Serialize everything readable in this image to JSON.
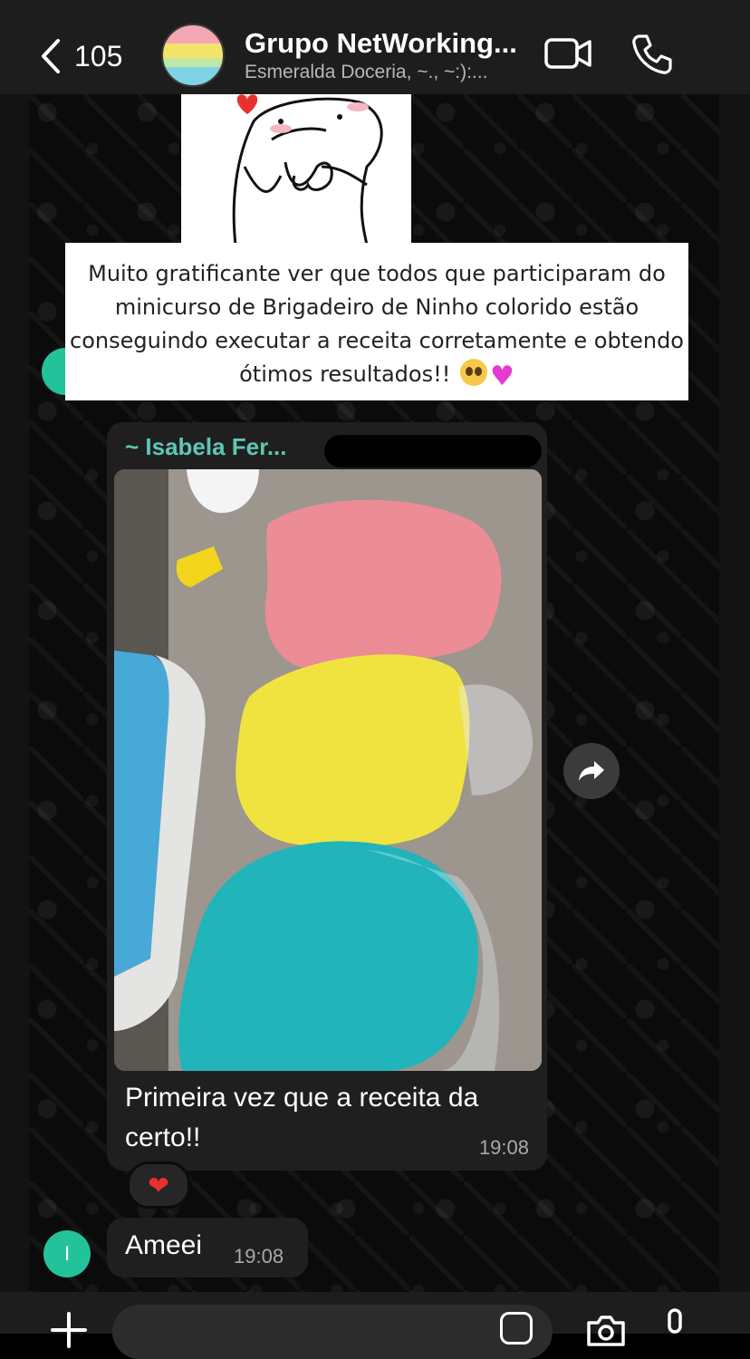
{
  "header": {
    "back_count": "105",
    "group_name": "Grupo NetWorking...",
    "members": "Esmeralda Doceria, ~., ~:):..."
  },
  "caption_card": {
    "text": "Muito gratificante ver que todos que participaram do minicurso de Brigadeiro de Ninho colorido estão conseguindo executar a receita corretamente e obtendo ótimos resultados!!"
  },
  "image_message": {
    "sender": "~ Isabela Fer...",
    "text": "Primeira vez que a receita da certo!!",
    "time": "19:08",
    "reaction": "❤"
  },
  "message_2": {
    "avatar_initial": "I",
    "text": "Ameei",
    "time": "19:08"
  },
  "colors": {
    "accent": "#23c29b",
    "sender_name": "#5fc7b0",
    "bubble": "#1f1f1f"
  },
  "icons": [
    "chevron-left-icon",
    "video-camera-icon",
    "phone-icon",
    "forward-icon",
    "plus-icon",
    "sticker-icon",
    "camera-icon",
    "microphone-icon"
  ]
}
